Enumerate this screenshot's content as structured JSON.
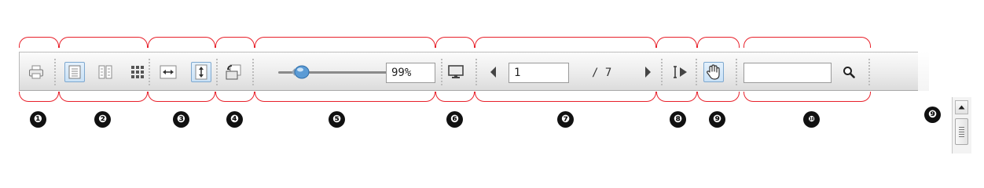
{
  "toolbar": {
    "zoom": {
      "value": "99%",
      "level_percent": 99
    },
    "page_nav": {
      "current_page": "1",
      "of_label": "/ 7"
    },
    "search": {
      "value": ""
    },
    "active_tools": [
      "single-page-view",
      "fit-height",
      "hand-tool"
    ]
  },
  "callouts": [
    {
      "number": "❶"
    },
    {
      "number": "❷"
    },
    {
      "number": "❸"
    },
    {
      "number": "❹"
    },
    {
      "number": "❺"
    },
    {
      "number": "❻"
    },
    {
      "number": "❼"
    },
    {
      "number": "❽"
    },
    {
      "number": "❾"
    },
    {
      "number": "❿"
    },
    {
      "number": "❾"
    }
  ],
  "colors": {
    "callout_bracket": "#e8202a",
    "active_button_bg": "#c9e1f6",
    "active_button_border": "#7ea8cf",
    "slider_thumb": "#5b9bd5"
  },
  "icons": [
    "printer-icon",
    "single-page-icon",
    "two-page-icon",
    "thumbnails-icon",
    "fit-width-icon",
    "fit-height-icon",
    "rotate-icon",
    "fullscreen-icon",
    "previous-page-icon",
    "next-page-icon",
    "text-select-icon",
    "hand-icon",
    "search-icon",
    "scroll-up-arrow-icon"
  ]
}
